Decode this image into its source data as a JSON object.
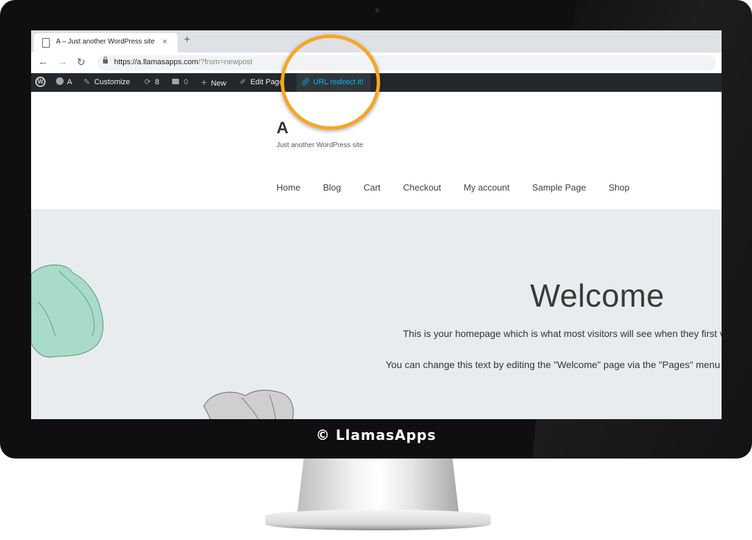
{
  "browser": {
    "tab_title": "A – Just another WordPress site",
    "tab_close": "×",
    "new_tab": "+",
    "url_host": "https://a.llamasapps.com",
    "url_path": "/?from=newpost"
  },
  "adminbar": {
    "site_name": "A",
    "customize": "Customize",
    "updates_count": "8",
    "comments_count": "0",
    "new_label": "New",
    "edit_page": "Edit Page",
    "url_redirect": "URL redirect it!"
  },
  "site": {
    "title": "A",
    "description": "Just another WordPress site",
    "nav": [
      "Home",
      "Blog",
      "Cart",
      "Checkout",
      "My account",
      "Sample Page",
      "Shop"
    ]
  },
  "hero": {
    "title": "Welcome",
    "line1": "This is your homepage which is what most visitors will see when they first v",
    "line2": "You can change this text by editing the \"Welcome\" page via the \"Pages\" menu i"
  },
  "watermark": "© LlamasApps",
  "colors": {
    "callout": "#f6a623",
    "link_highlight": "#00b9eb",
    "adminbar_bg": "#23282d",
    "hero_bg": "#e8ecef"
  }
}
